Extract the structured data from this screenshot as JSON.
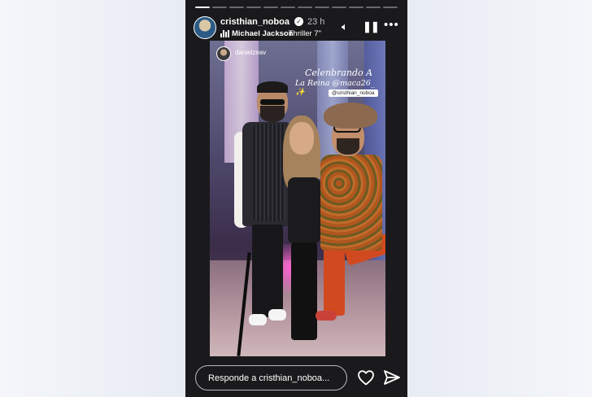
{
  "story": {
    "progress": {
      "segments": 12,
      "completed": 1
    },
    "header": {
      "username": "cristhian_noboa",
      "verified_icon": "verified-badge-icon",
      "time": "23 h",
      "music": {
        "icon": "music-bars-icon",
        "artist": "Michael Jackson",
        "track": "· Thriller 7\""
      },
      "controls": {
        "volume_icon": "volume-icon",
        "pause_icon": "pause-icon",
        "more_icon": "more-options-icon"
      }
    },
    "photo": {
      "tag_username": "danielzeav",
      "caption_line1": "Celenbrando A",
      "caption_line2": "La Reina @maca26_ ✨",
      "mention_sticker": "@cristhian_noboa"
    },
    "footer": {
      "reply_placeholder": "Responde a cristhian_noboa...",
      "like_icon": "heart-icon",
      "share_icon": "send-icon"
    }
  }
}
